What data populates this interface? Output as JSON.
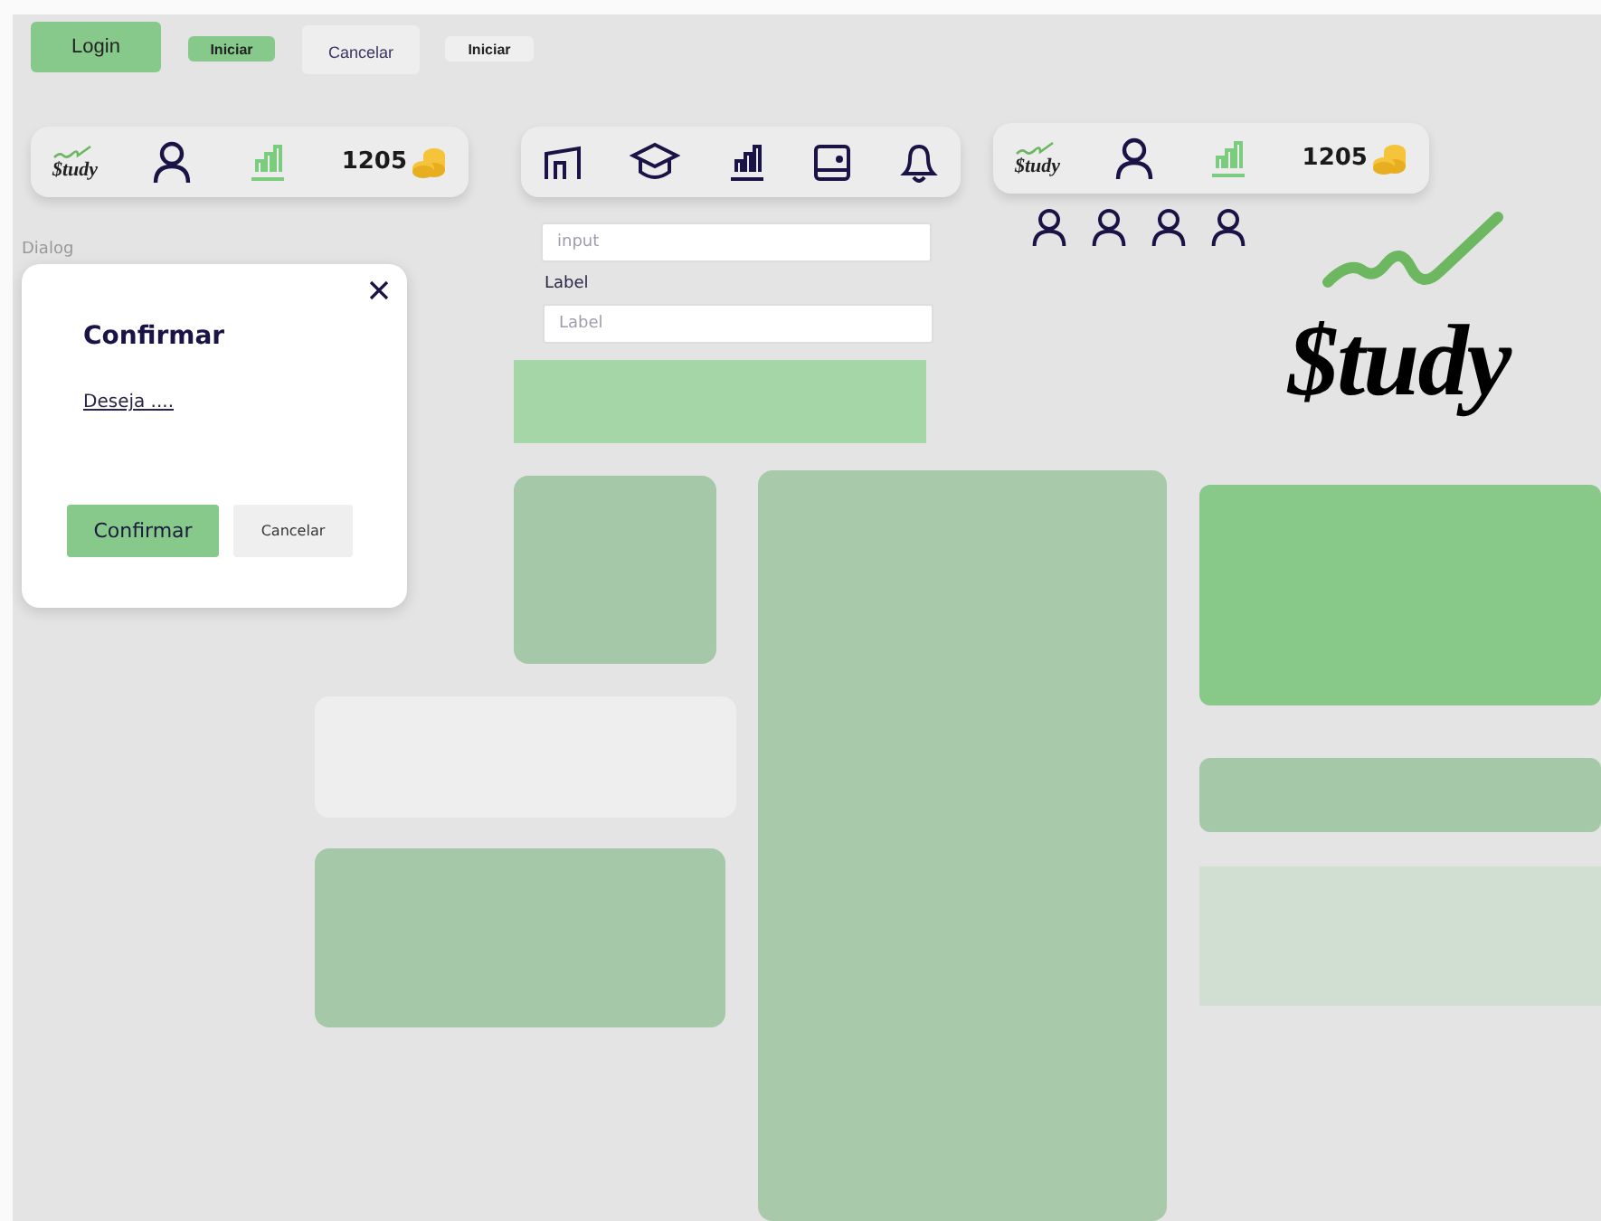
{
  "buttons": [
    {
      "label": "Login",
      "kind": "primary"
    },
    {
      "label": "Iniciar",
      "kind": "small-primary"
    },
    {
      "label": "Cancelar",
      "kind": "secondary"
    },
    {
      "label": "Iniciar",
      "kind": "small-secondary"
    }
  ],
  "navbars": [
    {
      "kind": "user",
      "logo": "$tudy",
      "coins": "1205"
    },
    {
      "kind": "menu"
    },
    {
      "kind": "user",
      "logo": "$tudy",
      "coins": "1205"
    }
  ],
  "input": {
    "placeholder": "input"
  },
  "labeled_input": {
    "label": "Label",
    "placeholder": "Label"
  },
  "dialog": {
    "caption": "Dialog",
    "title": "Confirmar",
    "message": "Deseja ....",
    "buttons": [
      {
        "label": "Confirmar",
        "kind": "primary"
      },
      {
        "label": "Cancelar",
        "kind": "secondary"
      }
    ]
  },
  "logo": {
    "text": "$tudy"
  }
}
